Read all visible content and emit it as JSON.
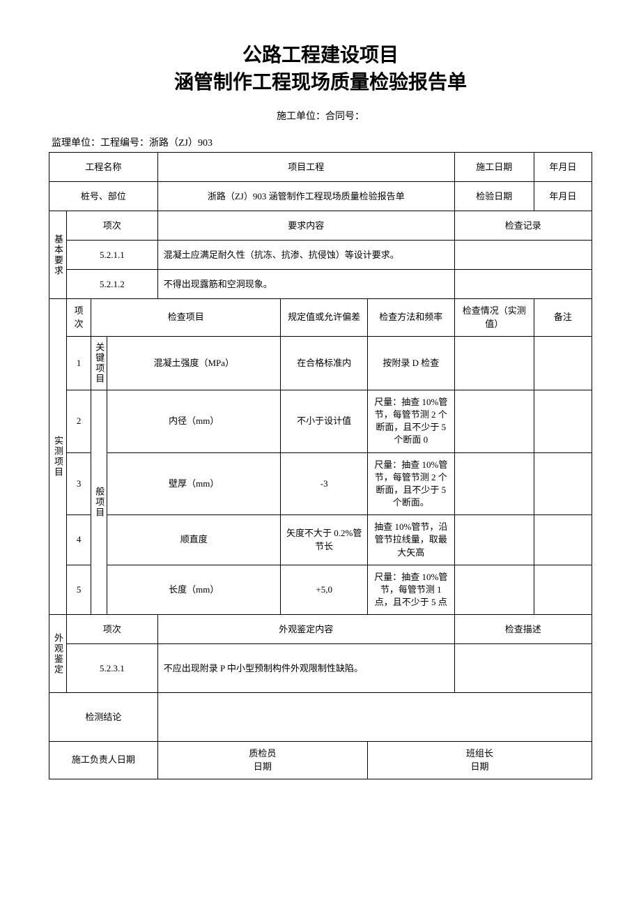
{
  "title_line1": "公路工程建设项目",
  "title_line2": "涵管制作工程现场质量检验报告单",
  "sub_line": "施工单位：合同号：",
  "meta_line": "监理单位：工程编号：浙路（ZJ）903",
  "header": {
    "proj_name_label": "工程名称",
    "proj_item_label": "项目工程",
    "construct_date_label": "施工日期",
    "date_value1": "年月日",
    "stake_label": "桩号、部位",
    "stake_value": "浙路（ZJ）903 涵管制作工程现场质量检验报告单",
    "inspect_date_label": "检验日期",
    "date_value2": "年月日"
  },
  "basic": {
    "side_label": "基本要求",
    "col1": "项次",
    "col2": "要求内容",
    "col3": "检查记录",
    "rows": [
      {
        "no": "5.2.1.1",
        "content": "混凝土应满足耐久性（抗冻、抗渗、抗侵蚀）等设计要求。"
      },
      {
        "no": "5.2.1.2",
        "content": "不得出现露筋和空洞现象。"
      }
    ]
  },
  "measure": {
    "side_label": "实测项目",
    "head": {
      "no": "项次",
      "item": "检查项目",
      "spec": "规定值或允许偏差",
      "method": "检查方法和频率",
      "record": "检查情况（实测值）",
      "note": "备注"
    },
    "key_label": "关键项目",
    "general_label": "般项目",
    "rows": [
      {
        "n": "1",
        "item": "混凝土强度（MPa）",
        "spec": "在合格标准内",
        "method": "按附录 D 检查"
      },
      {
        "n": "2",
        "item": "内径（mm）",
        "spec": "不小于设计值",
        "method": "尺量：抽查 10%管节，每管节测 2 个断面，且不少于 5 个断面 0"
      },
      {
        "n": "3",
        "item": "壁厚（mm）",
        "spec": "-3",
        "method": "尺量：抽查 10%管节，每管节测 2 个断面，且不少于 5 个断面。"
      },
      {
        "n": "4",
        "item": "顺直度",
        "spec": "矢度不大于 0.2%管节长",
        "method": "抽查 10%管节，沿管节拉线量，取最大矢高"
      },
      {
        "n": "5",
        "item": "长度（mm）",
        "spec": "+5,0",
        "method": "尺量：抽查 10%管节，每管节测 1 点，且不少于 5 点"
      }
    ]
  },
  "appearance": {
    "side_label": "外观鉴定",
    "col1": "项次",
    "col2": "外观鉴定内容",
    "col3": "检查描述",
    "row": {
      "no": "5.2.3.1",
      "content": "不应出现附录 P 中小型预制构件外观限制性缺陷。"
    }
  },
  "conclusion_label": "检测结论",
  "footer": {
    "c1": "施工负责人日期",
    "c2a": "质检员",
    "c2b": "日期",
    "c3a": "班组长",
    "c3b": "日期"
  }
}
